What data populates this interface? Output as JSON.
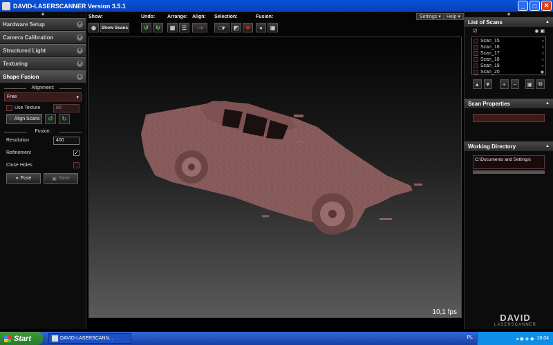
{
  "window": {
    "title": "DAVID-LASERSCANNER Version 3.5.1",
    "minimize": "_",
    "maximize": "□",
    "close": "✕"
  },
  "left_panel": {
    "sections": [
      "Hardware Setup",
      "Camera Calibration",
      "Structured Light",
      "Texturing"
    ],
    "active_section": "Shape Fusion",
    "alignment": {
      "label": "Alignment:",
      "mode": "Free",
      "use_texture_label": "Use Texture",
      "texture_value": "80",
      "align_button": "Align Scans"
    },
    "fusion": {
      "label": "Fusion:",
      "resolution_label": "Resolution",
      "resolution_value": "400",
      "refinement_label": "Refinement",
      "refinement_checked": "✓",
      "close_holes_label": "Close Holes",
      "fuse_button": "Fuse",
      "save_button": "Save"
    }
  },
  "toolbar": {
    "show_label": "Show:",
    "show_value": "Show Scans",
    "undo_label": "Undo:",
    "arrange_label": "Arrange:",
    "align_label": "Align:",
    "selection_label": "Selection:",
    "fusion_label": "Fusion:",
    "settings_menu": "Settings ▾",
    "help_menu": "Help ▾"
  },
  "viewport": {
    "fps": "10,1 fps"
  },
  "right_panel": {
    "list_title": "List of Scans",
    "scans": [
      "Scan_15",
      "Scan_16",
      "Scan_17",
      "Scan_18",
      "Scan_19",
      "Scan_20"
    ],
    "properties_title": "Scan Properties",
    "working_dir_title": "Working Directory",
    "working_dir_path": "C:\\Documents and Settings\\"
  },
  "logo": {
    "name": "DAVID",
    "sub": "LASERSCANNER"
  },
  "taskbar": {
    "start": "Start",
    "task": "DAVID-LASERSCANN...",
    "lang": "PL",
    "clock": "18:04"
  }
}
